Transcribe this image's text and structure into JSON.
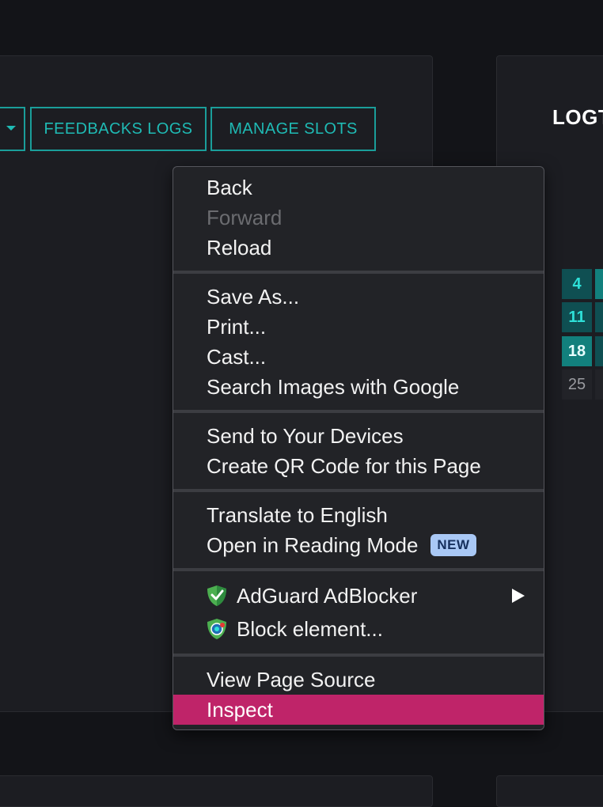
{
  "background_buttons": {
    "feedbacks_logs": "FEEDBACKS LOGS",
    "manage_slots": "MANAGE SLOTS"
  },
  "right_panel": {
    "title": "LOGT",
    "calendar": [
      "4",
      "11",
      "18",
      "25"
    ]
  },
  "context_menu": {
    "group1": {
      "back": "Back",
      "forward": "Forward",
      "reload": "Reload"
    },
    "group2": {
      "save_as": "Save As...",
      "print": "Print...",
      "cast": "Cast...",
      "search_images": "Search Images with Google"
    },
    "group3": {
      "send_devices": "Send to Your Devices",
      "qr_code": "Create QR Code for this Page"
    },
    "group4": {
      "translate": "Translate to English",
      "reading_mode": "Open in Reading Mode",
      "new_badge": "NEW"
    },
    "group5": {
      "adguard": "AdGuard AdBlocker",
      "block_element": "Block element..."
    },
    "group6": {
      "view_source": "View Page Source",
      "inspect": "Inspect"
    }
  },
  "colors": {
    "accent_teal": "#1fbab4",
    "highlight": "#bf2469",
    "badge_bg": "#a9c8f5",
    "adguard_green": "#4caf50"
  },
  "icons": {
    "adguard": "adguard-shield-icon",
    "block_element": "adguard-block-icon",
    "submenu": "submenu-arrow-icon",
    "dropdown": "caret-down-icon"
  }
}
